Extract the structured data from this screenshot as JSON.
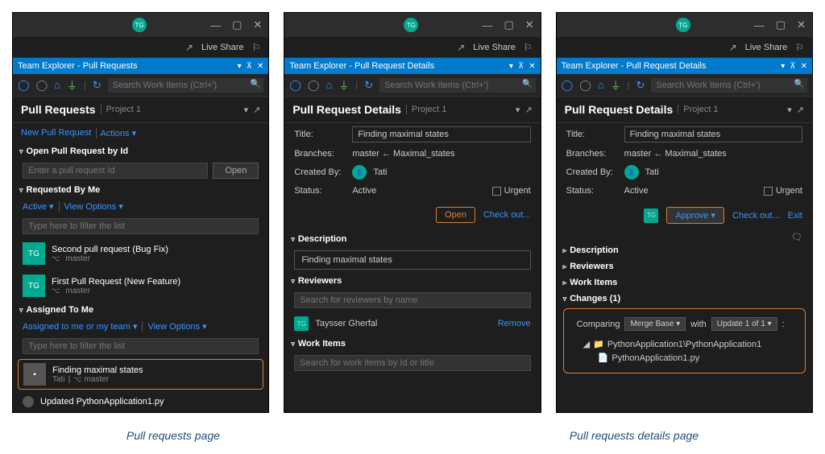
{
  "captions": {
    "left": "Pull requests page",
    "right": "Pull requests details page"
  },
  "common": {
    "liveShare": "Live Share",
    "searchPlaceholder": "Search Work Items (Ctrl+')",
    "avatar": "TG"
  },
  "panel1": {
    "tab": "Team Explorer - Pull Requests",
    "title": "Pull Requests",
    "project": "Project 1",
    "newPR": "New Pull Request",
    "actions": "Actions ▾",
    "openById": "Open Pull Request by Id",
    "prIdPlaceholder": "Enter a pull request Id",
    "openBtn": "Open",
    "requestedByMe": "Requested By Me",
    "active": "Active ▾",
    "viewOptions": "View Options ▾",
    "filterPlaceholder": "Type here to filter the list",
    "pr1": {
      "title": "Second pull request (Bug Fix)",
      "branch": "master"
    },
    "pr2": {
      "title": "First Pull Request (New Feature)",
      "branch": "master"
    },
    "assignedToMe": "Assigned To Me",
    "assignedFilter": "Assigned to me or my team ▾",
    "pr3": {
      "title": "Finding maximal states",
      "author": "Tati",
      "branch": "master"
    },
    "pr4": {
      "title": "Updated PythonApplication1.py"
    }
  },
  "panel2": {
    "tab": "Team Explorer - Pull Request Details",
    "title": "Pull Request Details",
    "project": "Project 1",
    "titleLabel": "Title:",
    "titleVal": "Finding maximal states",
    "branchesLabel": "Branches:",
    "branchesVal": "master  ←  Maximal_states",
    "createdByLabel": "Created By:",
    "createdByVal": "Tati",
    "statusLabel": "Status:",
    "statusVal": "Active",
    "urgent": "Urgent",
    "openBtn": "Open",
    "checkout": "Check out...",
    "description": "Description",
    "descVal": "Finding maximal states",
    "reviewers": "Reviewers",
    "reviewerSearch": "Search for reviewers by name",
    "reviewer1": "Taysser Gherfal",
    "remove": "Remove",
    "workItems": "Work Items",
    "wiSearch": "Search for work items by Id or title"
  },
  "panel3": {
    "tab": "Team Explorer - Pull Request Details",
    "title": "Pull Request Details",
    "project": "Project 1",
    "titleLabel": "Title:",
    "titleVal": "Finding maximal states",
    "branchesLabel": "Branches:",
    "branchesVal": "master  ←  Maximal_states",
    "createdByLabel": "Created By:",
    "createdByVal": "Tati",
    "statusLabel": "Status:",
    "statusVal": "Active",
    "urgent": "Urgent",
    "approve": "Approve ▾",
    "checkout": "Check out...",
    "exit": "Exit",
    "description": "Description",
    "reviewers": "Reviewers",
    "workItems": "Work Items",
    "changes": "Changes (1)",
    "comparing": "Comparing",
    "mergeBase": "Merge Base ▾",
    "with": "with",
    "update": "Update 1 of 1 ▾",
    "folder": "PythonApplication1\\PythonApplication1",
    "file": "PythonApplication1.py"
  }
}
